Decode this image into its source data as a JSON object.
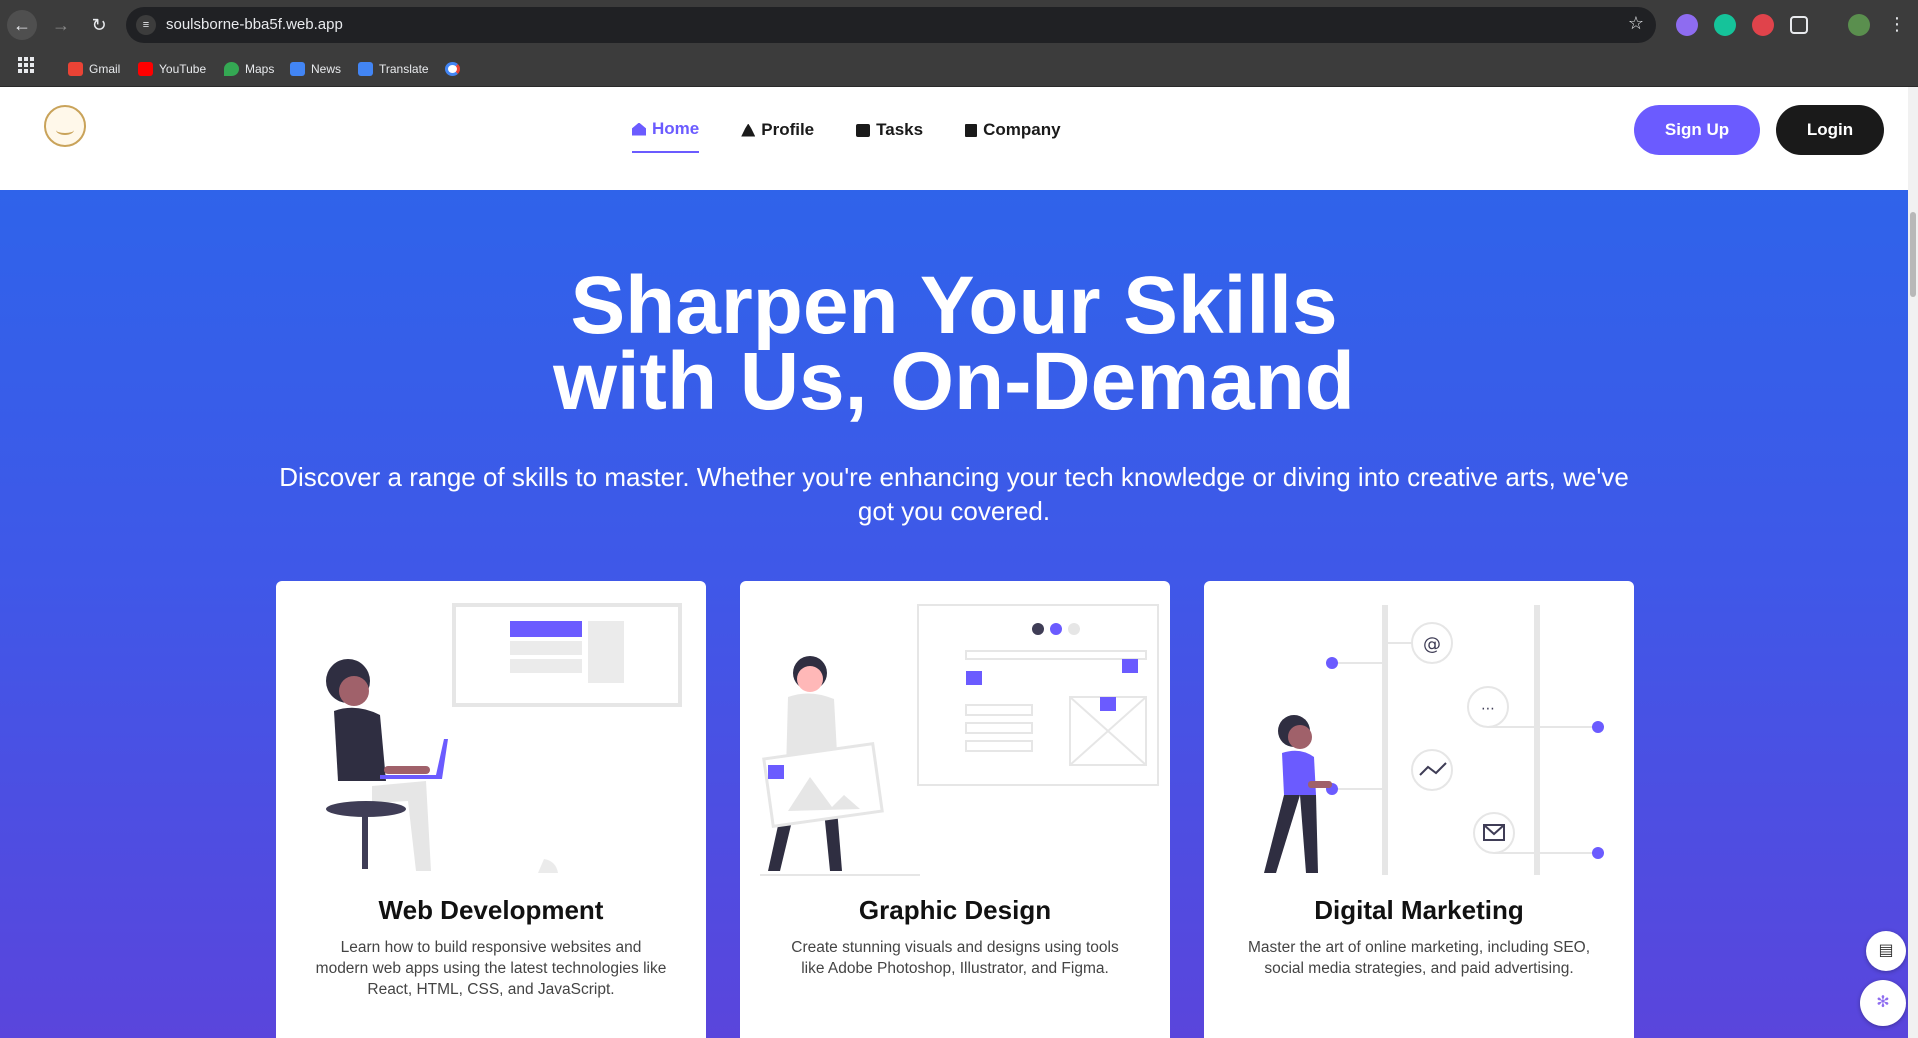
{
  "browser": {
    "url": "soulsborne-bba5f.web.app",
    "bookmarks": [
      {
        "label": "Gmail",
        "color": "#ea4335"
      },
      {
        "label": "YouTube",
        "color": "#ff0000"
      },
      {
        "label": "Maps",
        "color": "#34a853"
      },
      {
        "label": "News",
        "color": "#4285f4"
      },
      {
        "label": "Translate",
        "color": "#4285f4"
      }
    ]
  },
  "nav": {
    "items": [
      {
        "label": "Home",
        "icon": "home-icon",
        "active": true
      },
      {
        "label": "Profile",
        "icon": "profile-icon",
        "active": false
      },
      {
        "label": "Tasks",
        "icon": "briefcase-icon",
        "active": false
      },
      {
        "label": "Company",
        "icon": "building-icon",
        "active": false
      }
    ],
    "signup_label": "Sign Up",
    "login_label": "Login"
  },
  "hero": {
    "title_line1": "Sharpen Your Skills",
    "title_line2": "with Us, On-Demand",
    "subtitle": "Discover a range of skills to master. Whether you're enhancing your tech knowledge or diving into creative arts, we've got you covered."
  },
  "cards": [
    {
      "title": "Web Development",
      "description": "Learn how to build responsive websites and modern web apps using the latest technologies like React, HTML, CSS, and JavaScript."
    },
    {
      "title": "Graphic Design",
      "description": "Create stunning visuals and designs using tools like Adobe Photoshop, Illustrator, and Figma."
    },
    {
      "title": "Digital Marketing",
      "description": "Master the art of online marketing, including SEO, social media strategies, and paid advertising."
    }
  ],
  "colors": {
    "accent": "#6b5bff",
    "dark_button": "#1a1a1a",
    "hero_gradient_top": "#2f63ea",
    "hero_gradient_bottom": "#5a45dc"
  }
}
